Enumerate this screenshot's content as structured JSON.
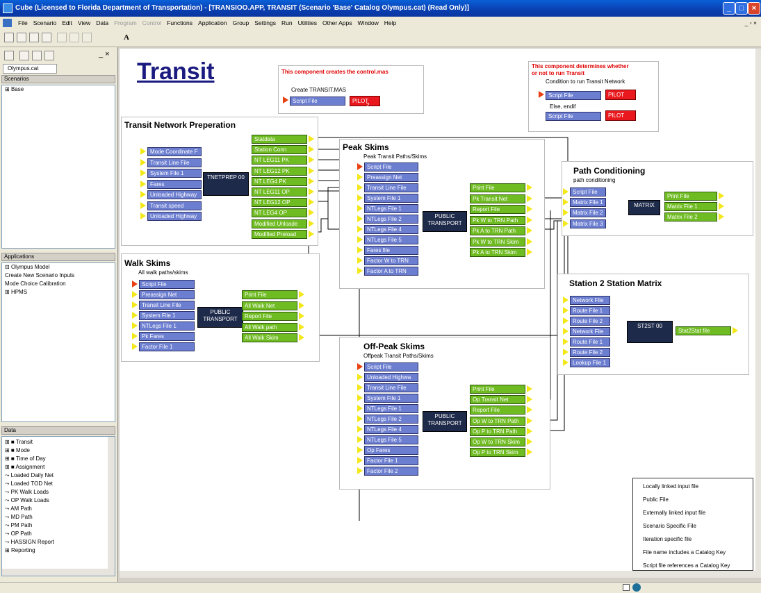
{
  "window": {
    "title": "Cube (Licensed to Florida Department of Transportation) - [TRANSIOO.APP, TRANSIT (Scenario 'Base' Catalog Olympus.cat) (Read Only)]"
  },
  "menu": [
    "File",
    "Scenario",
    "Edit",
    "View",
    "Data",
    "Program",
    "Control",
    "Functions",
    "Application",
    "Group",
    "Settings",
    "Run",
    "Utilities",
    "Other Apps",
    "Window",
    "Help"
  ],
  "menu_disabled": [
    "Program",
    "Control"
  ],
  "toolbar": {
    "font_label": "A"
  },
  "left": {
    "catalog_tab": "Olympus.cat",
    "scenarios_header": "Scenarios",
    "scenarios": [
      "Base"
    ],
    "applications_header": "Applications",
    "applications": [
      "Olympus Model",
      "Create New Scenario Inputs",
      "Mode Choice Calibration",
      "HPMS"
    ],
    "data_header": "Data",
    "data_tree": [
      "Transit",
      "Mode",
      "Time of Day",
      "Assignment",
      "Loaded Daily Net",
      "Loaded TOD Net",
      "PK Walk Loads",
      "OP Walk Loads",
      "AM Path",
      "MD Path",
      "PM Path",
      "OP Path",
      "HASSIGN Report",
      "Reporting"
    ]
  },
  "canvas": {
    "title": "Transit",
    "create_note": "This component creates the control.mas",
    "create_sub": "Create TRANSIT.MAS",
    "create_script": "Script File",
    "create_pilot": "PILOT",
    "create_pilot_num": "2",
    "determine_note1": "This component determines whether",
    "determine_note2": "or not to run Transit",
    "determine_sub": "Condition to run Transit Network",
    "det_script1": "Script File",
    "det_pilot1": "PILOT",
    "det_pilot1_num": "1",
    "det_else": "Else, endif",
    "det_script2": "Script File",
    "det_pilot2": "PILOT",
    "det_pilot2_num": "7",
    "tnp": {
      "title": "Transit Network Preperation",
      "inputs": [
        "Mode Coordinate F",
        "Transit Line File",
        "System File 1",
        "Fares",
        "Unloaded Highway",
        "Transit speed",
        "Unloaded Highway"
      ],
      "program": "TNETPREP 00",
      "program_num": "3",
      "outputs": [
        "Statdata",
        "Station Conn",
        "NT LEG11 PK",
        "NT LEG12 PK",
        "NT LEG4 PK",
        "NT LEG11 OP",
        "NT LEG12 OP",
        "NT LEG4 OP",
        "Modified Unloade",
        "Modified Preload"
      ]
    },
    "walk": {
      "title": "Walk Skims",
      "sub": "All walk paths/skims",
      "inputs": [
        "Script File",
        "Preassign Net",
        "Transit Line File",
        "System File 1",
        "NTLegs File 1",
        "Pk Fares",
        "Factor File 1"
      ],
      "program": "PUBLIC TRANSPORT",
      "program_num": "4",
      "outputs": [
        "Print File",
        "All Walk Net",
        "Report File",
        "All Walk path",
        "All Walk Skim"
      ]
    },
    "peak": {
      "title": "Peak Skims",
      "sub": "Peak Transit Paths/Skims",
      "inputs": [
        "Script File",
        "Preassign Net",
        "Transit Line File",
        "System File 1",
        "NTLegs File 1",
        "NTLegs File 2",
        "NTLegs File 4",
        "NTLegs File 5",
        "Fares file",
        "Factor W to TRN",
        "Factor A to TRN"
      ],
      "program": "PUBLIC TRANSPORT",
      "program_num": "5",
      "outputs": [
        "Print File",
        "Pk Transit Net",
        "Report File",
        "Pk W to TRN Path",
        "Pk A to TRN Path",
        "Pk W to TRN Skim",
        "Pk A to TRN Skim"
      ]
    },
    "offpeak": {
      "title": "Off-Peak Skims",
      "sub": "Offpeak Transit Paths/Skims",
      "inputs": [
        "Script File",
        "Unloaded Highwa",
        "Transit Line File",
        "System File 1",
        "NTLegs File 1",
        "NTLegs File 2",
        "NTLegs File 4",
        "NTLegs File 5",
        "Op Fares",
        "Factor File 1",
        "Factor File 2"
      ],
      "program": "PUBLIC TRANSPORT",
      "program_num": "6",
      "outputs": [
        "Print File",
        "Op Transit Net",
        "Report File",
        "Op W to TRN Path",
        "Op P to TRN Path",
        "Op W to TRN Skim",
        "Op P to TRN Skim"
      ]
    },
    "pathcond": {
      "title": "Path Conditioning",
      "sub": "path conditioning",
      "inputs": [
        "Script File",
        "Matrix File 1",
        "Matrix File 2",
        "Matrix File 3"
      ],
      "program": "MATRIX",
      "program_num": "7",
      "outputs": [
        "Print File",
        "Matrix File 1",
        "Matrix File 2"
      ]
    },
    "s2s": {
      "title": "Station 2 Station Matrix",
      "inputs": [
        "Network File",
        "Route File 1",
        "Route File 2",
        "Network File",
        "Route File 1",
        "Route File 2",
        "Lookup File 1"
      ],
      "program": "ST2ST 00",
      "program_num": "8",
      "outputs": [
        "Stat2Stat file"
      ]
    },
    "legend": [
      "Locally linked input file",
      "Public File",
      "Externally linked input file",
      "Scenario Specific File",
      "Iteration specific file",
      "File name includes a Catalog Key",
      "Script file references a Catalog Key"
    ]
  },
  "colors": {
    "input_file": "#6c7ed0",
    "output_file": "#6fbb22",
    "program": "#1e2a4a",
    "pilot": "#e8181e",
    "title_blue": "#1a1a80"
  }
}
